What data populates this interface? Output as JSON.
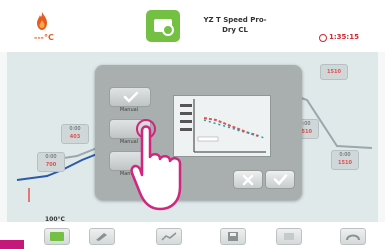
{
  "header": {
    "temperature_label": "---°C",
    "program_name_line1": "YZ T Speed Pro-",
    "program_name_line2": "Dry CL",
    "timer": "1:35:15"
  },
  "chart_chips": {
    "left_top": {
      "line1": "0:00",
      "value": "403"
    },
    "left_bottom": {
      "line1": "0:00",
      "value": "700"
    },
    "right_top": {
      "line1": "",
      "value": "1510"
    },
    "right_mid": {
      "line1": "0:00",
      "value": "1510"
    },
    "right_bottom": {
      "line1": "0:00",
      "value": "1510"
    }
  },
  "start_temperature": "100°C",
  "dialog": {
    "option1": "Manual",
    "option2": "Manual",
    "option3": "Manual"
  },
  "colors": {
    "accent_green": "#74c043",
    "timer_red": "#d2262e",
    "corner_magenta": "#c6177a"
  }
}
